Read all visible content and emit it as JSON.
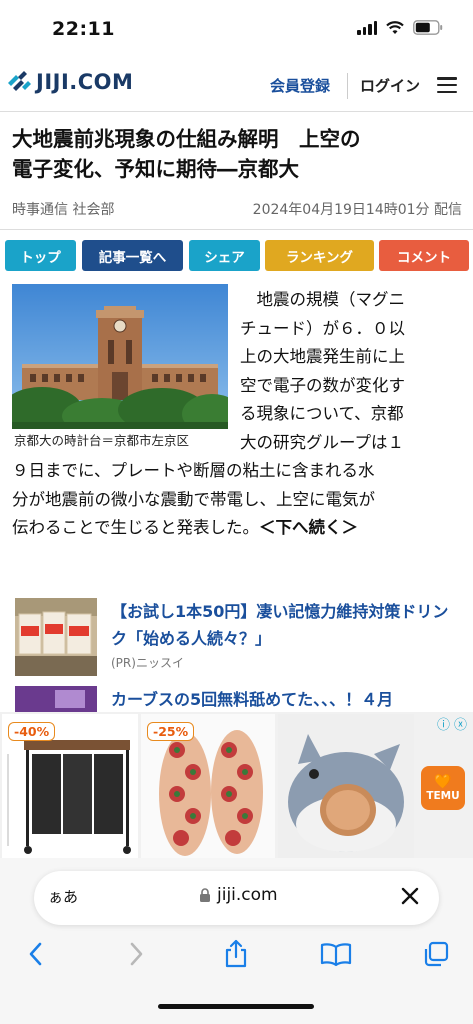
{
  "status": {
    "time": "22:11"
  },
  "header": {
    "logo": "JIJI.COM",
    "register": "会員登録",
    "login": "ログイン"
  },
  "article": {
    "title_line1": "大地震前兆現象の仕組み解明　上空の",
    "title_line2": "電子変化、予知に期待―京都大",
    "source": "時事通信 社会部",
    "date": "2024年04月19日14時01分 配信",
    "photo_caption": "京都大の時計台＝京都市左京区",
    "body_lines_right": [
      "　地震の規模（マグニ",
      "チュード）が６．０以",
      "上の大地震発生前に上",
      "空で電子の数が変化す",
      "る現象について、京都",
      "大の研究グループは１"
    ],
    "body_lines_full": [
      "９日までに、プレートや断層の粘土に含まれる水",
      "分が地震前の微小な震動で帯電し、上空に電気が",
      "伝わることで生じると発表した。"
    ],
    "read_more": "＜下へ続く＞"
  },
  "nav_buttons": {
    "top": "トップ",
    "list": "記事一覧へ",
    "share": "シェア",
    "ranking": "ランキング",
    "comment": "コメント"
  },
  "promos": [
    {
      "title": "【お試し1本50円】凄い記憶力維持対策ドリンク「始める人続々？」",
      "sponsor": "(PR)ニッスイ"
    },
    {
      "title": "カーブスの5回無料舐めてた、、、！４月"
    }
  ],
  "ad": {
    "badge1": "-40%",
    "badge2": "-25%",
    "brand": "TEMU"
  },
  "browser": {
    "aa": "ぁあ",
    "url": "jiji.com"
  }
}
